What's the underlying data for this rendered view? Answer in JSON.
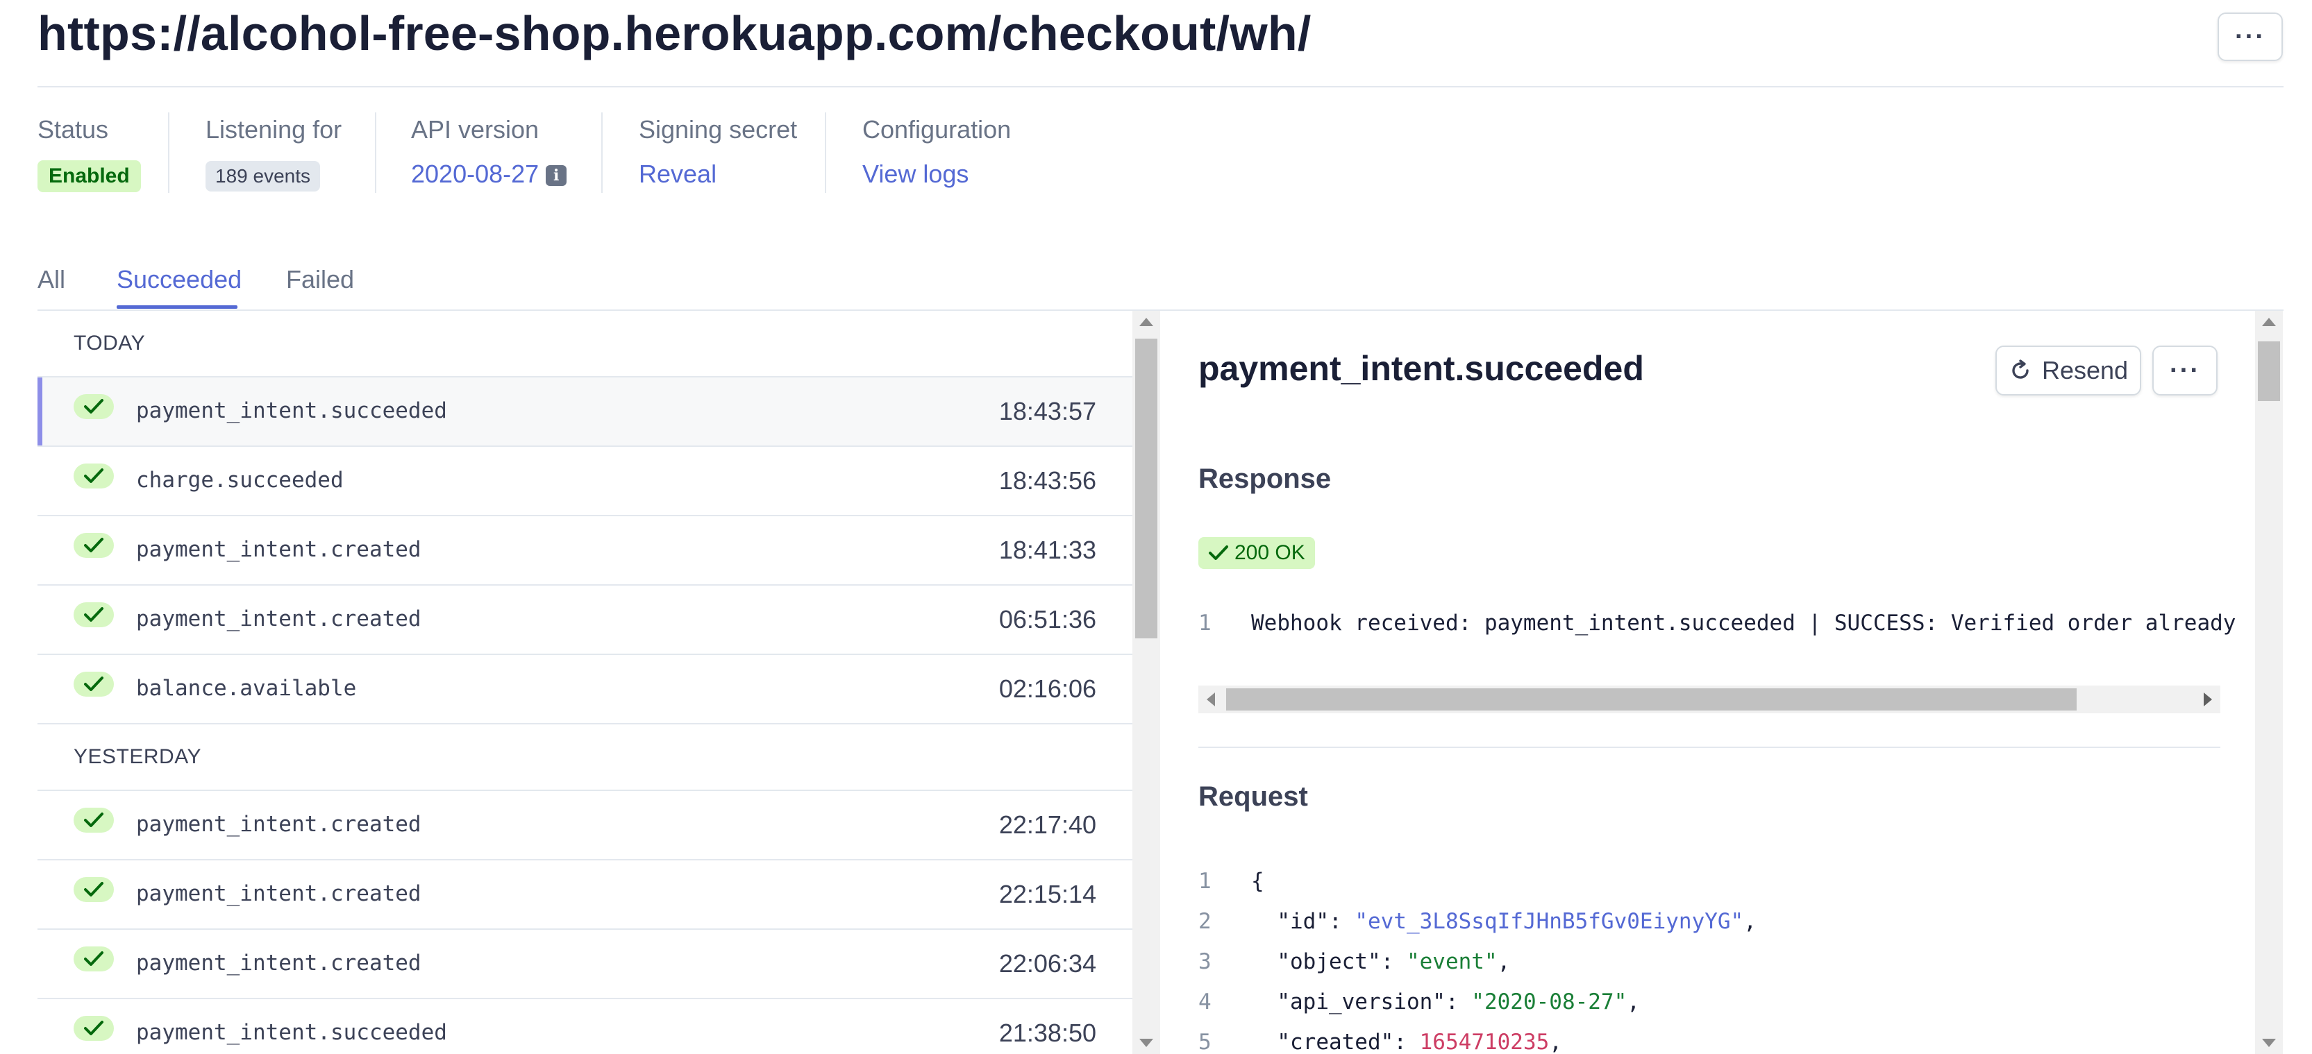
{
  "header": {
    "endpoint_url": "https://alcohol-free-shop.herokuapp.com/checkout/wh/",
    "more_label": "···"
  },
  "meta": {
    "status_label": "Status",
    "status_value": "Enabled",
    "listening_label": "Listening for",
    "listening_value": "189 events",
    "api_label": "API version",
    "api_value": "2020-08-27",
    "api_info_icon": "i",
    "secret_label": "Signing secret",
    "secret_value": "Reveal",
    "config_label": "Configuration",
    "config_value": "View logs"
  },
  "tabs": [
    {
      "label": "All",
      "active": false
    },
    {
      "label": "Succeeded",
      "active": true
    },
    {
      "label": "Failed",
      "active": false
    }
  ],
  "events": {
    "groups": [
      {
        "label": "TODAY",
        "items": [
          {
            "name": "payment_intent.succeeded",
            "time": "18:43:57",
            "selected": true
          },
          {
            "name": "charge.succeeded",
            "time": "18:43:56"
          },
          {
            "name": "payment_intent.created",
            "time": "18:41:33"
          },
          {
            "name": "payment_intent.created",
            "time": "06:51:36"
          },
          {
            "name": "balance.available",
            "time": "02:16:06"
          }
        ]
      },
      {
        "label": "YESTERDAY",
        "items": [
          {
            "name": "payment_intent.created",
            "time": "22:17:40"
          },
          {
            "name": "payment_intent.created",
            "time": "22:15:14"
          },
          {
            "name": "payment_intent.created",
            "time": "22:06:34"
          },
          {
            "name": "payment_intent.succeeded",
            "time": "21:38:50"
          }
        ]
      }
    ]
  },
  "detail": {
    "title": "payment_intent.succeeded",
    "resend_label": "Resend",
    "more_label": "···",
    "response_title": "Response",
    "response_status": "200 OK",
    "response_lines": [
      {
        "num": "1",
        "text": "Webhook received: payment_intent.succeeded | SUCCESS: Verified order already"
      }
    ],
    "request_title": "Request",
    "request_lines": [
      {
        "num": "1",
        "text": "{"
      },
      {
        "num": "2",
        "key": "\"id\"",
        "value": "\"evt_3L8SsqIfJHnB5fGv0EiynyYG\"",
        "kind": "blue"
      },
      {
        "num": "3",
        "key": "\"object\"",
        "value": "\"event\"",
        "kind": "green"
      },
      {
        "num": "4",
        "key": "\"api_version\"",
        "value": "\"2020-08-27\"",
        "kind": "green"
      },
      {
        "num": "5",
        "key": "\"created\"",
        "value": "1654710235",
        "kind": "red"
      }
    ]
  },
  "colors": {
    "accent": "#5469d4",
    "success_bg": "#d7f7c2",
    "success_fg": "#05690d",
    "selected_bar": "#8d8ee8"
  }
}
